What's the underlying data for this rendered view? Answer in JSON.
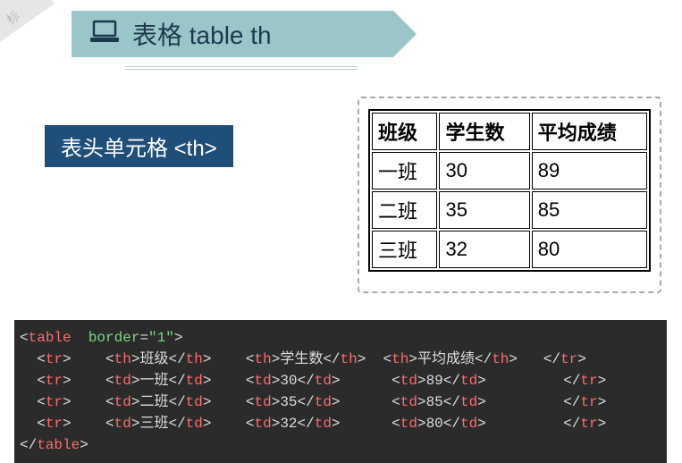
{
  "corner_tag": "标",
  "header": {
    "title": "表格 table  th",
    "icon_name": "laptop-icon"
  },
  "subtitle": "表头单元格 <th>",
  "table": {
    "headers": [
      "班级",
      "学生数",
      "平均成绩"
    ],
    "rows": [
      [
        "一班",
        "30",
        "89"
      ],
      [
        "二班",
        "35",
        "85"
      ],
      [
        "三班",
        "32",
        "80"
      ]
    ]
  },
  "code": {
    "open_tag": "table",
    "border_attr": "border",
    "border_val": "\"1\"",
    "tr": "tr",
    "th": "th",
    "td": "td",
    "close_tag": "table",
    "header_cells": [
      "班级",
      "学生数",
      "平均成绩"
    ],
    "data_rows": [
      [
        "一班",
        "30",
        "89"
      ],
      [
        "二班",
        "35",
        "85"
      ],
      [
        "三班",
        "32",
        "80"
      ]
    ]
  }
}
